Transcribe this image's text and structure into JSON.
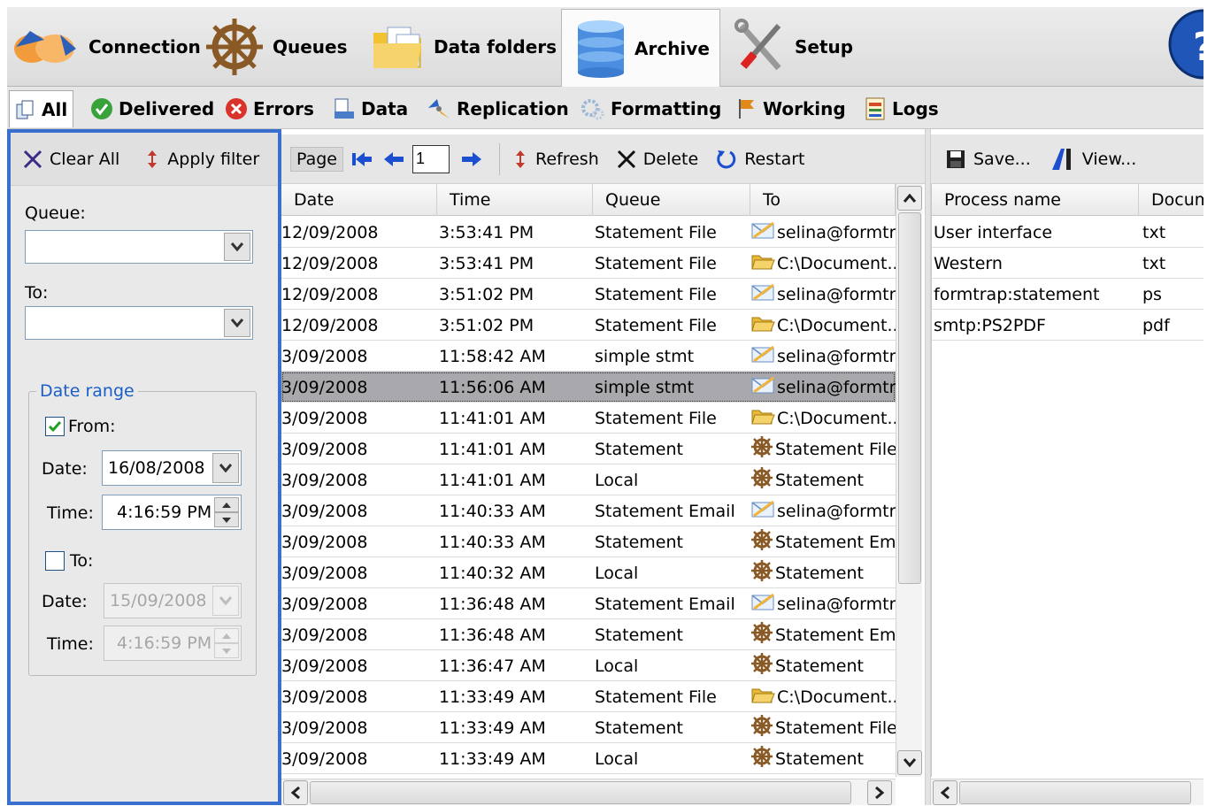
{
  "toolbar": {
    "connection": "Connection",
    "queues": "Queues",
    "data_folders": "Data folders",
    "archive": "Archive",
    "setup": "Setup"
  },
  "tabs": {
    "all": "All",
    "delivered": "Delivered",
    "errors": "Errors",
    "data": "Data",
    "replication": "Replication",
    "formatting": "Formatting",
    "working": "Working",
    "logs": "Logs"
  },
  "filter": {
    "clear_all": "Clear All",
    "apply_filter": "Apply filter",
    "queue_label": "Queue:",
    "queue_value": "",
    "to_label": "To:",
    "to_value": "",
    "date_range_legend": "Date range",
    "from_label": "From:",
    "from_checked": true,
    "from_date_label": "Date:",
    "from_date": "16/08/2008",
    "from_time_label": "Time:",
    "from_time": "4:16:59 PM",
    "to_check_label": "To:",
    "to_checked": false,
    "to_date_label": "Date:",
    "to_date": "15/09/2008",
    "to_time_label": "Time:",
    "to_time": "4:16:59 PM"
  },
  "grid_toolbar": {
    "page_label": "Page",
    "page_value": "1",
    "refresh": "Refresh",
    "delete": "Delete",
    "restart": "Restart"
  },
  "grid": {
    "columns": [
      "Date",
      "Time",
      "Queue",
      "To"
    ],
    "rows": [
      {
        "date": "12/09/2008",
        "time": "3:53:41 PM",
        "queue": "Statement File",
        "to": "selina@formtr.",
        "icon": "envelope-icon"
      },
      {
        "date": "12/09/2008",
        "time": "3:53:41 PM",
        "queue": "Statement File",
        "to": "C:\\Document..",
        "icon": "folder-icon"
      },
      {
        "date": "12/09/2008",
        "time": "3:51:02 PM",
        "queue": "Statement File",
        "to": "selina@formtr.",
        "icon": "envelope-icon"
      },
      {
        "date": "12/09/2008",
        "time": "3:51:02 PM",
        "queue": "Statement File",
        "to": "C:\\Document..",
        "icon": "folder-icon"
      },
      {
        "date": "3/09/2008",
        "time": "11:58:42 AM",
        "queue": "simple stmt",
        "to": "selina@formtr.",
        "icon": "envelope-icon"
      },
      {
        "date": "3/09/2008",
        "time": "11:56:06 AM",
        "queue": "simple stmt",
        "to": "selina@formtr.",
        "icon": "envelope-icon",
        "selected": true
      },
      {
        "date": "3/09/2008",
        "time": "11:41:01 AM",
        "queue": "Statement File",
        "to": "C:\\Document..",
        "icon": "folder-icon"
      },
      {
        "date": "3/09/2008",
        "time": "11:41:01 AM",
        "queue": "Statement",
        "to": "Statement File",
        "icon": "wheel-icon"
      },
      {
        "date": "3/09/2008",
        "time": "11:41:01 AM",
        "queue": "Local",
        "to": "Statement",
        "icon": "wheel-icon"
      },
      {
        "date": "3/09/2008",
        "time": "11:40:33 AM",
        "queue": "Statement Email",
        "to": "selina@formtr.",
        "icon": "envelope-icon"
      },
      {
        "date": "3/09/2008",
        "time": "11:40:33 AM",
        "queue": "Statement",
        "to": "Statement Ema",
        "icon": "wheel-icon"
      },
      {
        "date": "3/09/2008",
        "time": "11:40:32 AM",
        "queue": "Local",
        "to": "Statement",
        "icon": "wheel-icon"
      },
      {
        "date": "3/09/2008",
        "time": "11:36:48 AM",
        "queue": "Statement Email",
        "to": "selina@formtr.",
        "icon": "envelope-icon"
      },
      {
        "date": "3/09/2008",
        "time": "11:36:48 AM",
        "queue": "Statement",
        "to": "Statement Ema",
        "icon": "wheel-icon"
      },
      {
        "date": "3/09/2008",
        "time": "11:36:47 AM",
        "queue": "Local",
        "to": "Statement",
        "icon": "wheel-icon"
      },
      {
        "date": "3/09/2008",
        "time": "11:33:49 AM",
        "queue": "Statement File",
        "to": "C:\\Document..",
        "icon": "folder-icon"
      },
      {
        "date": "3/09/2008",
        "time": "11:33:49 AM",
        "queue": "Statement",
        "to": "Statement File",
        "icon": "wheel-icon"
      },
      {
        "date": "3/09/2008",
        "time": "11:33:49 AM",
        "queue": "Local",
        "to": "Statement",
        "icon": "wheel-icon"
      }
    ]
  },
  "right_toolbar": {
    "save": "Save...",
    "view": "View..."
  },
  "right_grid": {
    "columns": [
      "Process name",
      "Docum"
    ],
    "rows": [
      {
        "process": "User interface",
        "doc": "txt"
      },
      {
        "process": "Western",
        "doc": "txt"
      },
      {
        "process": "formtrap:statement",
        "doc": "ps"
      },
      {
        "process": "smtp:PS2PDF",
        "doc": "pdf"
      }
    ]
  },
  "colors": {
    "accent": "#3a6fd0",
    "selected_row": "#a9a9ad",
    "legend": "#1a5ec8"
  }
}
